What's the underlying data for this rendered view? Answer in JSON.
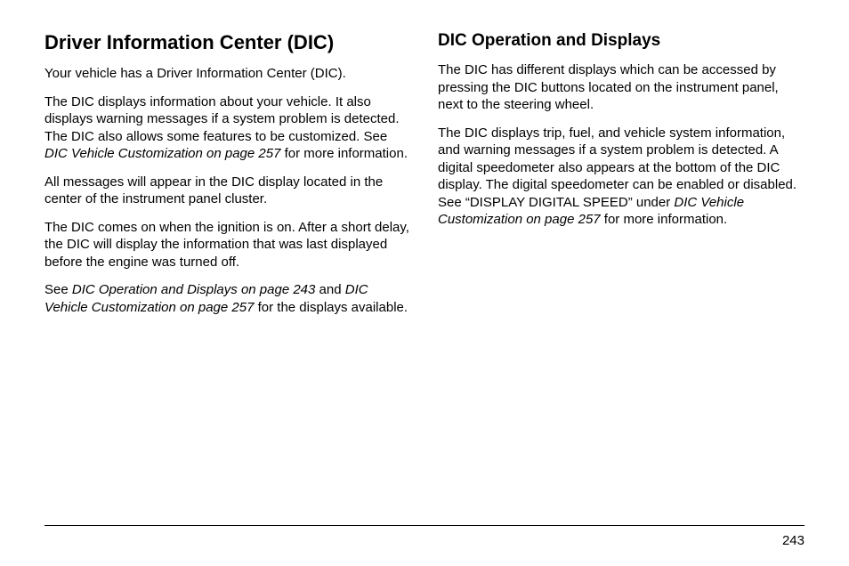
{
  "left": {
    "heading": "Driver Information Center (DIC)",
    "p1": "Your vehicle has a Driver Information Center (DIC).",
    "p2a": "The DIC displays information about your vehicle. It also displays warning messages if a system problem is detected. The DIC also allows some features to be customized. See ",
    "p2_ref": "DIC Vehicle Customization on page 257",
    "p2b": " for more information.",
    "p3": "All messages will appear in the DIC display located in the center of the instrument panel cluster.",
    "p4": "The DIC comes on when the ignition is on. After a short delay, the DIC will display the information that was last displayed before the engine was turned off.",
    "p5a": "See ",
    "p5_ref1": "DIC Operation and Displays on page 243",
    "p5b": " and ",
    "p5_ref2": "DIC Vehicle Customization on page 257",
    "p5c": " for the displays available."
  },
  "right": {
    "heading": "DIC Operation and Displays",
    "p1": "The DIC has different displays which can be accessed by pressing the DIC buttons located on the instrument panel, next to the steering wheel.",
    "p2a": "The DIC displays trip, fuel, and vehicle system information, and warning messages if a system problem is detected. A digital speedometer also appears at the bottom of the DIC display. The digital speedometer can be enabled or disabled. See “DISPLAY DIGITAL SPEED” under ",
    "p2_ref": "DIC Vehicle Customization on page 257",
    "p2b": " for more information."
  },
  "page_number": "243"
}
